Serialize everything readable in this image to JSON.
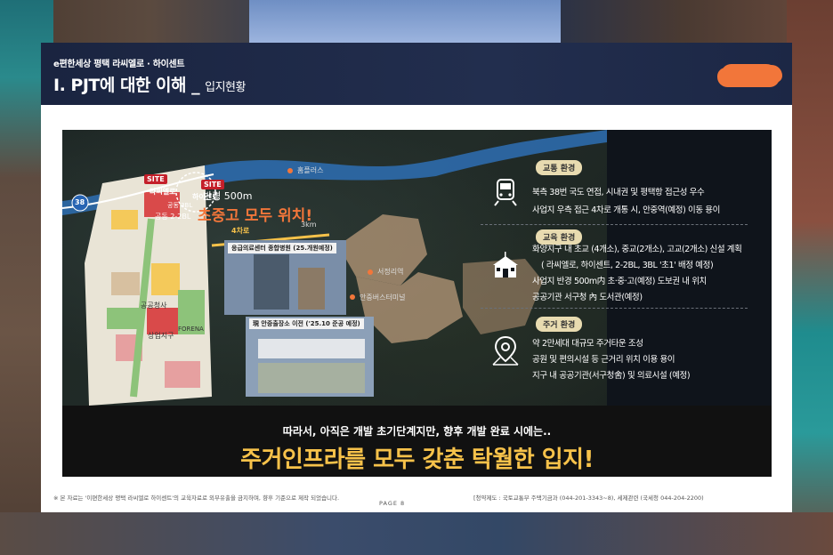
{
  "header": {
    "brand": "e편한세상 평택 라씨엘로 · 하이센트",
    "title": "Ⅰ. PJT에 대한 이해 _",
    "subtitle": "입지현황"
  },
  "map": {
    "site_label_1": "SITE",
    "site_name_1": "라씨엘로",
    "site_label_2": "SITE",
    "site_name_2": "하이센트",
    "radius_label": "반경 500m",
    "headline": "초중고 모두 위치!",
    "road_label": "4차로",
    "distance_3km": "3km",
    "parcel_1": "공동 2-2BL",
    "parcel_2": "공동 3BL",
    "homeplus": "홈플러스",
    "seojeong": "서정리역",
    "bus_terminal": "안중버스터미널",
    "route": "38",
    "forena": "FORENA",
    "public": "공공청사",
    "center": "상업지구",
    "photo1_caption": "응급의료센터 종합병원 (25.개원예정)",
    "photo2_caption": "現 안중출장소 이전 ('25.10 준공 예정)"
  },
  "panel": {
    "transport": {
      "title": "교통 환경",
      "icon": "train-icon",
      "lines": [
        "북측 38번 국도 연접, 시내권 및 평택항 접근성 우수",
        "사업지 우측 접근 4차로 개통 시, 안중역(예정) 이동 용이"
      ]
    },
    "education": {
      "title": "교육 환경",
      "icon": "school-icon",
      "lines": [
        "화양지구 내 초교 (4개소), 중교(2개소), 고교(2개소) 신설 계획",
        "( 라씨엘로, 하이센트, 2-2BL, 3BL '초1' 배정 예정)",
        "사업지 반경 500m内 초·중·고(예정) 도보권 내 위치",
        "공공기관 서구청 內 도서관(예정)"
      ]
    },
    "living": {
      "title": "주거 환경",
      "icon": "location-pin-icon",
      "lines": [
        "약 2만세대 대규모 주거타운 조성",
        "공원 및 편의시설 등 근거리 위치 이용 용이",
        "지구 내 공공기관(서구청舍) 및 의료시설 (예정)"
      ]
    }
  },
  "bottom": {
    "line1": "따라서, 아직은 개발 초기단계지만, 향후 개발 완료 시에는..",
    "line2": "주거인프라를 모두 갖춘 탁월한 입지!"
  },
  "footer": {
    "note": "※ 본 자료는 '이편한세상 평택 라씨엘로 하이센트'의 교육자료로 외부유출을 금지하며, 향후 기준으로 제작 되었습니다.",
    "page": "PAGE 8",
    "contact": "[청약제도 : 국토교통부 주택기금과 (044-201-3343~8),  세제관련 (국세청 044-204-2200)"
  }
}
